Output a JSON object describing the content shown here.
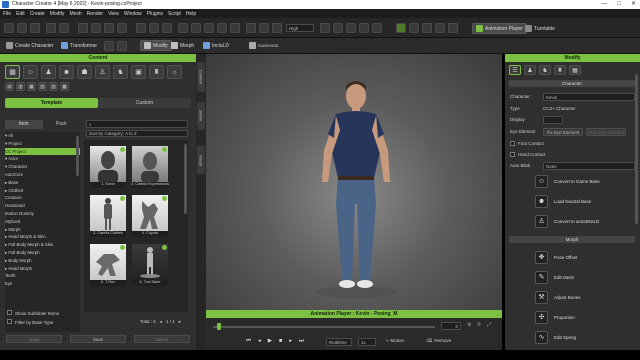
{
  "window": {
    "title": "Character Creator 4 [May 6 2022] - Kevin-posing.ccProject",
    "controls": [
      "—",
      "□",
      "✕"
    ]
  },
  "menu": [
    "File",
    "Edit",
    "Create",
    "Modify",
    "Mesh",
    "Render",
    "View",
    "Window",
    "Plugins",
    "Script",
    "Help"
  ],
  "toolbar": {
    "quality": "High",
    "animation_player": "Animation Player",
    "turntable": "Turntable"
  },
  "toolbar2": {
    "create_character": "Create Character",
    "transformer": "Transformer",
    "modify": "Modify",
    "morph": "Morph",
    "include_ld": "IncluLD",
    "subdivide": "SUBDIVIDE"
  },
  "content": {
    "header": "Content",
    "tabs": {
      "template": "Template",
      "custom": "Custom"
    },
    "subtabs": {
      "item": "Item",
      "pack": "Pack"
    },
    "sort": "Sort by Category: A to Z",
    "tree": [
      "▾ All",
      "  ▾ Project",
      "     CC Project",
      "  ▾ Actor",
      "    ▾ Character",
      "       AutoCore",
      "     ▸ Base",
      "     ▸ Clothed",
      "       Creature",
      "       Humanoid",
      "       Motion Dummy",
      "       Stylized",
      "   ▸ Morph",
      "   ▸ Head Morph & Skin",
      "   ▸ Full Body Morph & Skin",
      "   ▸ Full Body Morph",
      "   ▸ Body Morph",
      "   ▸ Head Morph",
      "     Teeth",
      "     Eye"
    ],
    "thumbnails": [
      "1. Kevin",
      "2. Camila Expressions",
      "3. Camila Clothes",
      "4. Coyote",
      "5. T-Rex",
      "6. TurnTable"
    ],
    "show_subfolder": "Show Subfolder Items",
    "filter_base": "Filter by Base Type",
    "total": "Total : 6",
    "page": "1 / 1",
    "apply_label": "Apply",
    "save_label": "Save",
    "delete_label": "Delete"
  },
  "side_tabs": [
    "Content",
    "Scene",
    "Visual"
  ],
  "animation": {
    "title": "Animation Player : Kevin - Posing_M",
    "frame": "0",
    "realtime": "Realtime",
    "speed": "1x",
    "motion": "Motion",
    "remove": "Remove",
    "progress": 0.02
  },
  "modify": {
    "header": "Modify",
    "character_section": "Character",
    "character_label": "Character:",
    "character_value": "Kevin",
    "type_label": "Type",
    "type_value": "CC3+ Character",
    "display_label": "Display",
    "eye_element_label": "Eye Element",
    "fix_eye": "Fix Eye Element",
    "eye_disabled": "Auto Eye Element",
    "foot_contact": "Foot Contact",
    "hand_contact": "Hand Contact",
    "auto_blink_label": "Auto Blink",
    "auto_blink_value": "None",
    "buttons_top": [
      "Convert to Game Base",
      "Load Neutral Base",
      "Convert to actorBUILD"
    ],
    "morph_section": "Morph",
    "buttons_bottom": [
      "Pose Offset",
      "Edit Mesh",
      "Adjust Bones",
      "Proportion",
      "Edit Spring"
    ]
  },
  "colors": {
    "accent": "#7cc142",
    "panel": "#2f2f2f",
    "dark": "#262626"
  }
}
